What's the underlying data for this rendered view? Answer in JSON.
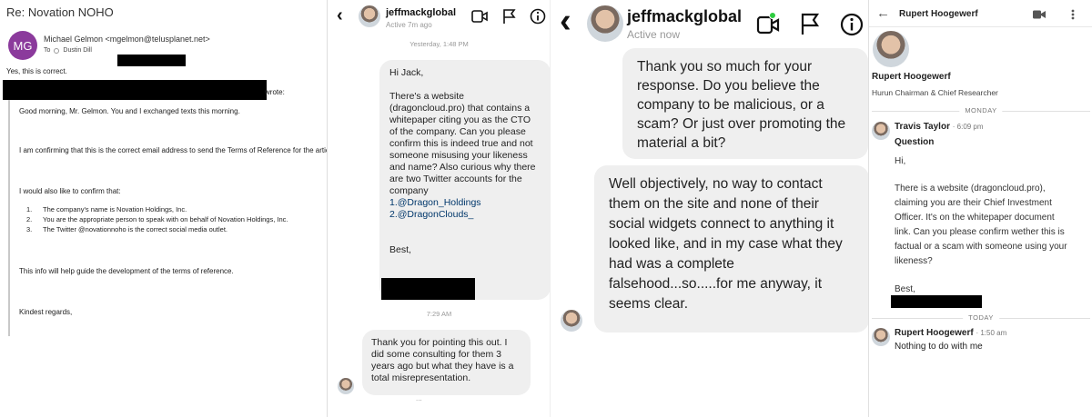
{
  "email": {
    "subject": "Re: Novation NOHO",
    "avatar_initials": "MG",
    "from": "Michael Gelmon <mgelmon@telusplanet.net>",
    "to_label": "To",
    "to_name": "Dustin Dill",
    "reply_text": "Yes, this is correct.",
    "wrote": "wrote:",
    "greeting": "Good morning, Mr. Gelmon. You and I exchanged texts this morning.",
    "confirm_email": "I am confirming that this is the correct email address to send the Terms of Reference for the article.",
    "confirm_intro": "I would also like to confirm that:",
    "list": [
      {
        "n": "1.",
        "text": "The company's name is Novation Holdings, Inc."
      },
      {
        "n": "2.",
        "text": "You are the appropriate person to speak with on behalf of Novation Holdings, Inc."
      },
      {
        "n": "3.",
        "text": "The Twitter @novationnoho is the correct social media outlet."
      }
    ],
    "info": "This info will help guide the development of the terms of reference.",
    "closing": "Kindest regards,"
  },
  "ig_small": {
    "username": "jeffmackglobal",
    "status": "Active 7m ago",
    "timestamp1": "Yesterday, 1:48 PM",
    "msg1": {
      "greeting": "Hi Jack,",
      "body": "There's a website (dragoncloud.pro) that contains a whitepaper citing you as the CTO of the company. Can you please confirm this is indeed true and not someone misusing your likeness and name? Also curious why there are two Twitter accounts for the company",
      "link1": "1.@Dragon_Holdings",
      "link2": "2.@DragonClouds_",
      "signoff": "Best,"
    },
    "timestamp2": "7:29 AM",
    "msg2": "Thank you for pointing this out. I did some consulting for them 3 years ago but what they have is a total misrepresentation.",
    "typing": "..."
  },
  "ig_large": {
    "username": "jeffmackglobal",
    "status": "Active now",
    "msg1": "Thank you so much for your response. Do you believe the company to be malicious, or a scam? Or just over promoting the material a bit?",
    "msg2": "Well objectively, no way to contact them on the site and none of their social widgets connect to anything it looked like, and in my case what they had was a complete falsehood...so.....for me anyway, it seems clear."
  },
  "linkedin": {
    "top_name": "Rupert Hoogewerf",
    "profile_name": "Rupert Hoogewerf",
    "profile_title": "Hurun Chairman & Chief Researcher",
    "day1": "MONDAY",
    "sender1": "Travis Taylor",
    "time1": "6:09 pm",
    "subject": "Question",
    "body_lines": [
      "Hi,",
      "",
      "There is a website (dragoncloud.pro),",
      "claiming you are their Chief Investment",
      "Officer. It's on the whitepaper document",
      "link. Can you please confirm wether this is",
      "factual or a scam with someone using your",
      "likeness?",
      "",
      "Best,"
    ],
    "day2": "TODAY",
    "sender2": "Rupert Hoogewerf",
    "time2": "1:50 am",
    "reply": "Nothing to do with me"
  }
}
